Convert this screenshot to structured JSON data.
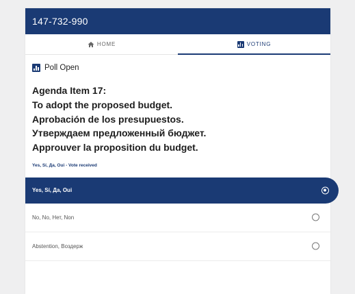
{
  "header": {
    "meeting_id": "147-732-990"
  },
  "tabs": [
    {
      "label": "HOME",
      "icon": "home-icon",
      "active": false
    },
    {
      "label": "VOTING",
      "icon": "chart-icon",
      "active": true
    }
  ],
  "poll": {
    "status": "Poll Open",
    "agenda_lines": [
      "Agenda Item 17:",
      "To adopt the proposed budget.",
      "Aprobación de los presupuestos.",
      "Утверждаем предложенный бюджет.",
      "Approuver la proposition du budget."
    ],
    "vote_status": "Yes, Sí, Да, Oui - Vote received"
  },
  "options": [
    {
      "label": "Yes, Sí, Да, Oui",
      "selected": true
    },
    {
      "label": "No, No, Нет, Non",
      "selected": false
    },
    {
      "label": "Abstention, Воздерж",
      "selected": false
    }
  ],
  "colors": {
    "brand": "#1a3a74",
    "background": "#efeff0"
  }
}
